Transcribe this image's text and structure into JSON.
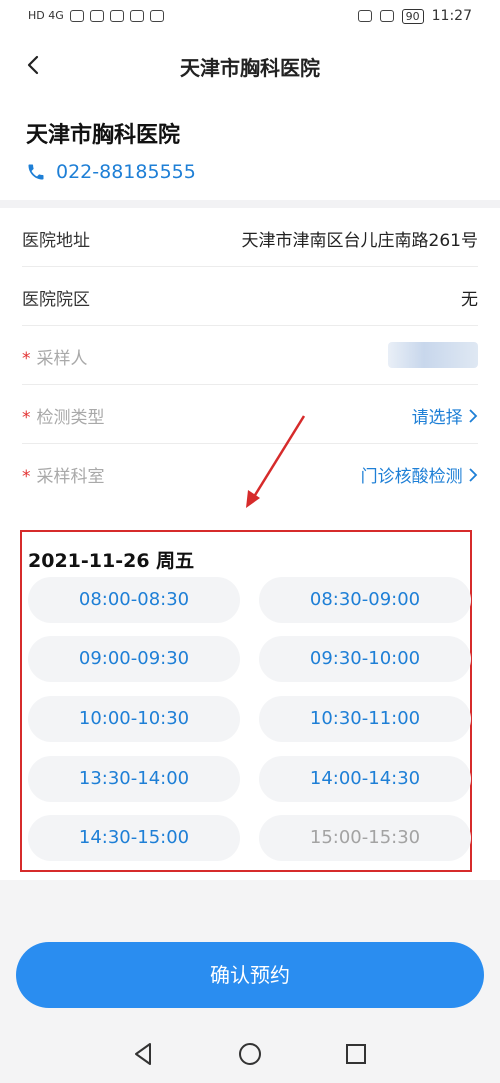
{
  "status_bar": {
    "left_text": "HD 4G",
    "battery": "90",
    "time": "11:27"
  },
  "nav": {
    "title": "天津市胸科医院"
  },
  "hospital": {
    "name": "天津市胸科医院",
    "phone": "022-88185555"
  },
  "form": {
    "address_label": "医院地址",
    "address_value": "天津市津南区台儿庄南路261号",
    "campus_label": "医院院区",
    "campus_value": "无",
    "sampler_label": "采样人",
    "test_type_label": "检测类型",
    "test_type_value": "请选择",
    "dept_label": "采样科室",
    "dept_value": "门诊核酸检测",
    "required_mark": "*"
  },
  "schedule": {
    "date": "2021-11-26  周五",
    "slots": [
      {
        "label": "08:00-08:30"
      },
      {
        "label": "08:30-09:00"
      },
      {
        "label": "09:00-09:30"
      },
      {
        "label": "09:30-10:00"
      },
      {
        "label": "10:00-10:30"
      },
      {
        "label": "10:30-11:00"
      },
      {
        "label": "13:30-14:00"
      },
      {
        "label": "14:00-14:30"
      },
      {
        "label": "14:30-15:00"
      },
      {
        "label": "15:00-15:30"
      }
    ]
  },
  "confirm_label": "确认预约",
  "colors": {
    "accent": "#1e7fd6",
    "button": "#2a8df0",
    "highlight_box": "#d62b2b",
    "required": "#e23232"
  }
}
